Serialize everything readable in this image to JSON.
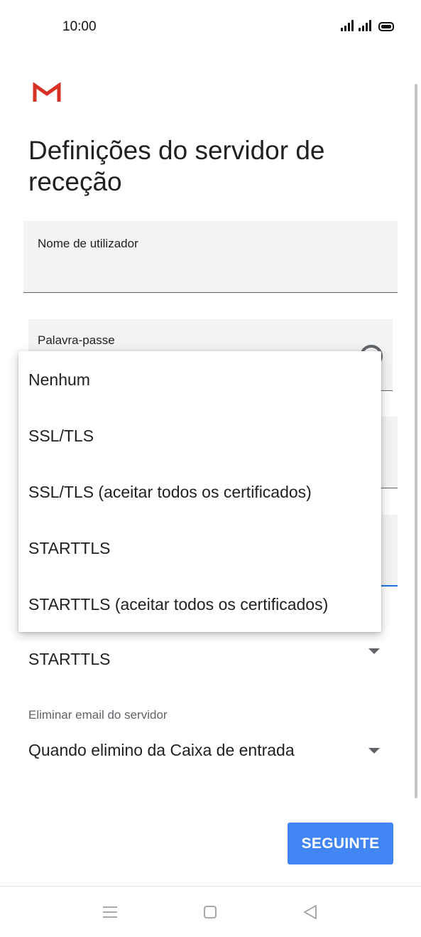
{
  "status_bar": {
    "time": "10:00"
  },
  "app": {
    "logo": "gmail-logo",
    "brand_color": "#d93025"
  },
  "page": {
    "title": "Definições do servidor de receção"
  },
  "form": {
    "username_label": "Nome de utilizador",
    "password_label": "Palavra-passe",
    "security_type_value": "STARTTLS",
    "delete_email_label": "Eliminar email do servidor",
    "delete_email_value": "Quando elimino da Caixa de entrada"
  },
  "security_menu": {
    "options": [
      "Nenhum",
      "SSL/TLS",
      "SSL/TLS (aceitar todos os certificados)",
      "STARTTLS",
      "STARTTLS (aceitar todos os certificados)"
    ]
  },
  "actions": {
    "next_label": "SEGUINTE",
    "next_color": "#4285f4"
  },
  "nav_bar": {
    "icons": [
      "menu-icon",
      "home-icon",
      "back-icon"
    ]
  }
}
